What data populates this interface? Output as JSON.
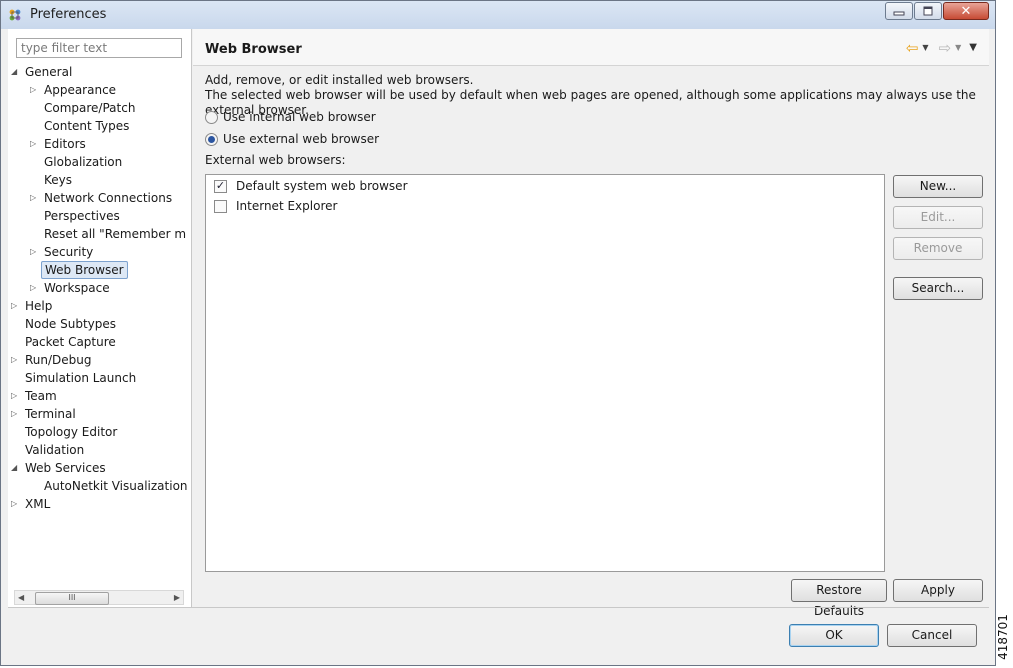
{
  "window": {
    "title": "Preferences",
    "controls": {
      "minimize": "▭",
      "maximize": "□",
      "close": "✕"
    }
  },
  "filter": {
    "placeholder": "type filter text"
  },
  "tree": {
    "nodes": [
      {
        "label": "General",
        "level": 0,
        "twisty": "expanded"
      },
      {
        "label": "Appearance",
        "level": 1,
        "twisty": "collapsed"
      },
      {
        "label": "Compare/Patch",
        "level": 1,
        "twisty": "none"
      },
      {
        "label": "Content Types",
        "level": 1,
        "twisty": "none"
      },
      {
        "label": "Editors",
        "level": 1,
        "twisty": "collapsed"
      },
      {
        "label": "Globalization",
        "level": 1,
        "twisty": "none"
      },
      {
        "label": "Keys",
        "level": 1,
        "twisty": "none"
      },
      {
        "label": "Network Connections",
        "level": 1,
        "twisty": "collapsed"
      },
      {
        "label": "Perspectives",
        "level": 1,
        "twisty": "none"
      },
      {
        "label": "Reset all \"Remember m",
        "level": 1,
        "twisty": "none"
      },
      {
        "label": "Security",
        "level": 1,
        "twisty": "collapsed"
      },
      {
        "label": "Web Browser",
        "level": 1,
        "twisty": "none",
        "selected": true
      },
      {
        "label": "Workspace",
        "level": 1,
        "twisty": "collapsed"
      },
      {
        "label": "Help",
        "level": 0,
        "twisty": "collapsed"
      },
      {
        "label": "Node Subtypes",
        "level": 0,
        "twisty": "none"
      },
      {
        "label": "Packet Capture",
        "level": 0,
        "twisty": "none"
      },
      {
        "label": "Run/Debug",
        "level": 0,
        "twisty": "collapsed"
      },
      {
        "label": "Simulation Launch",
        "level": 0,
        "twisty": "none"
      },
      {
        "label": "Team",
        "level": 0,
        "twisty": "collapsed"
      },
      {
        "label": "Terminal",
        "level": 0,
        "twisty": "collapsed"
      },
      {
        "label": "Topology Editor",
        "level": 0,
        "twisty": "none"
      },
      {
        "label": "Validation",
        "level": 0,
        "twisty": "none"
      },
      {
        "label": "Web Services",
        "level": 0,
        "twisty": "expanded"
      },
      {
        "label": "AutoNetkit Visualization",
        "level": 1,
        "twisty": "none"
      },
      {
        "label": "XML",
        "level": 0,
        "twisty": "collapsed"
      }
    ],
    "scrollbar_grip": "III"
  },
  "page": {
    "title": "Web Browser",
    "description_line1": "Add, remove, or edit installed web browsers.",
    "description_line2": "The selected web browser will be used by default when web pages are opened, although some applications may always use the external browser.",
    "radio_internal": {
      "label": "Use internal web browser",
      "selected": false
    },
    "radio_external": {
      "label": "Use external web browser",
      "selected": true
    },
    "external_label": "External web browsers:",
    "browsers": [
      {
        "label": "Default system web browser",
        "checked": true
      },
      {
        "label": "Internet Explorer",
        "checked": false
      }
    ],
    "buttons": {
      "new": "New...",
      "edit": "Edit...",
      "remove": "Remove",
      "search": "Search...",
      "restore_defaults": "Restore Defaults",
      "apply": "Apply"
    }
  },
  "dialog_buttons": {
    "ok": "OK",
    "cancel": "Cancel"
  },
  "figure_id": "418701",
  "colors": {
    "selection_bg": "#dde8f5",
    "selection_border": "#7da2ce",
    "back_arrow": "#e8a31c"
  }
}
